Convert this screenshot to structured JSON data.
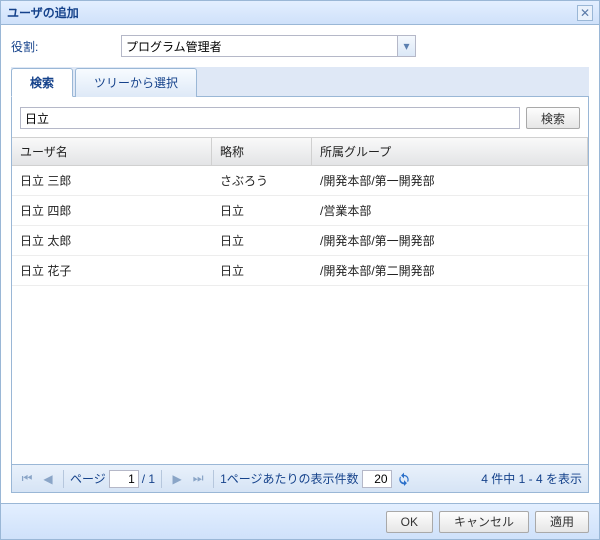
{
  "window": {
    "title": "ユーザの追加"
  },
  "role": {
    "label": "役割:",
    "value": "プログラム管理者"
  },
  "tabs": {
    "search": "検索",
    "tree": "ツリーから選択"
  },
  "search": {
    "value": "日立",
    "button": "検索"
  },
  "grid": {
    "headers": {
      "user": "ユーザ名",
      "abbr": "略称",
      "group": "所属グループ"
    },
    "rows": [
      {
        "user": "日立 三郎",
        "abbr": "さぶろう",
        "group": "/開発本部/第一開発部"
      },
      {
        "user": "日立 四郎",
        "abbr": "日立",
        "group": "/営業本部"
      },
      {
        "user": "日立 太郎",
        "abbr": "日立",
        "group": "/開発本部/第一開発部"
      },
      {
        "user": "日立 花子",
        "abbr": "日立",
        "group": "/開発本部/第二開発部"
      }
    ]
  },
  "pager": {
    "page_label": "ページ",
    "page_value": "1",
    "page_total": "/ 1",
    "per_page_label": "1ページあたりの表示件数",
    "per_page_value": "20",
    "status": "4 件中 1 - 4 を表示"
  },
  "buttons": {
    "ok": "OK",
    "cancel": "キャンセル",
    "apply": "適用"
  }
}
